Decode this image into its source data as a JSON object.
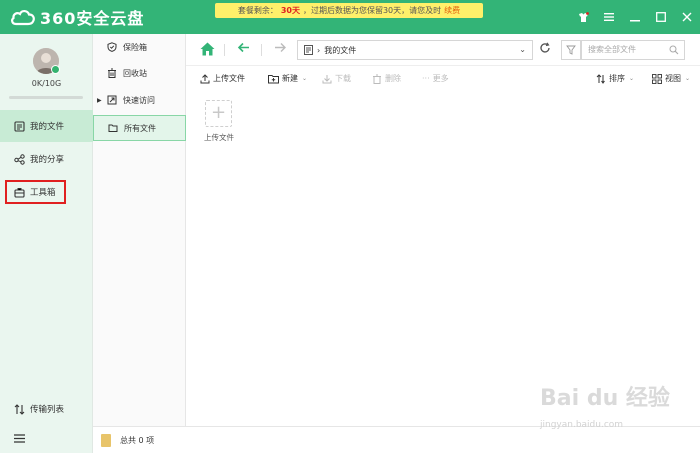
{
  "app": {
    "logo_text": "360安全云盘"
  },
  "notice": {
    "prefix": "套餐剩余：",
    "days": "30天",
    "middle": "，过期后数据为您保留30天，请您及时",
    "renew": "续费"
  },
  "account": {
    "quota": "0K/10G",
    "usage_fraction": 0.0
  },
  "sidebar": {
    "items": [
      {
        "label": "我的文件",
        "active": true
      },
      {
        "label": "我的分享",
        "active": false
      },
      {
        "label": "工具箱",
        "active": false
      }
    ],
    "transfer": "传输列表"
  },
  "col2": {
    "items": [
      {
        "label": "保险箱"
      },
      {
        "label": "回收站"
      },
      {
        "label": "快速访问"
      },
      {
        "label": "所有文件"
      }
    ]
  },
  "address": {
    "path": "我的文件",
    "search_placeholder": "搜索全部文件"
  },
  "toolbar": {
    "upload": "上传文件",
    "new": "新建",
    "download": "下载",
    "delete": "删除",
    "more": "更多",
    "sort": "排序",
    "view": "视图"
  },
  "main": {
    "upload_tile_label": "上传文件"
  },
  "status": {
    "summary": "总共 0 项"
  },
  "watermark": {
    "brand": "Bai du 经验",
    "url": "jingyan.baidu.com"
  },
  "colors": {
    "brand_green": "#33b477",
    "notice_yellow": "#fff06a",
    "highlight_red": "#e02020"
  }
}
